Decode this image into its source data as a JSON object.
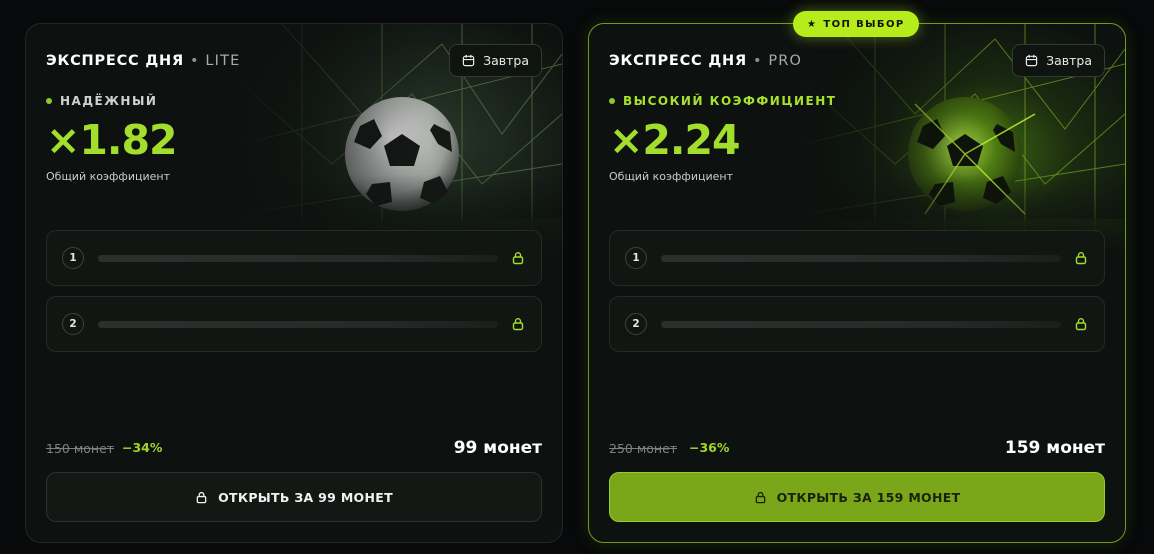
{
  "cards": [
    {
      "title": "ЭКСПРЕСС ДНЯ",
      "tier": "LITE",
      "date_label": "Завтра",
      "badge": "НАДЁЖНЫЙ",
      "coefficient": "×1.82",
      "coefficient_label": "Общий коэффициент",
      "rows": [
        {
          "number": "1"
        },
        {
          "number": "2"
        }
      ],
      "old_price": "150 монет",
      "discount": "−34%",
      "price": "99 монет",
      "cta_label": "ОТКРЫТЬ ЗА 99 МОНЕТ"
    },
    {
      "top_badge": "ТОП ВЫБОР",
      "title": "ЭКСПРЕСС ДНЯ",
      "tier": "PRO",
      "date_label": "Завтра",
      "badge": "ВЫСОКИЙ КОЭФФИЦИЕНТ",
      "coefficient": "×2.24",
      "coefficient_label": "Общий коэффициент",
      "rows": [
        {
          "number": "1"
        },
        {
          "number": "2"
        }
      ],
      "old_price": "250 монет",
      "discount": "−36%",
      "price": "159 монет",
      "cta_label": "ОТКРЫТЬ ЗА 159 МОНЕТ"
    }
  ],
  "icons": {
    "calendar": "calendar-icon",
    "lock": "lock-icon",
    "star": "star-icon",
    "football": "football-image"
  },
  "colors": {
    "accent": "#a3de2c",
    "pill": "#b6ec1c",
    "cta_pro": "#7aa719"
  }
}
